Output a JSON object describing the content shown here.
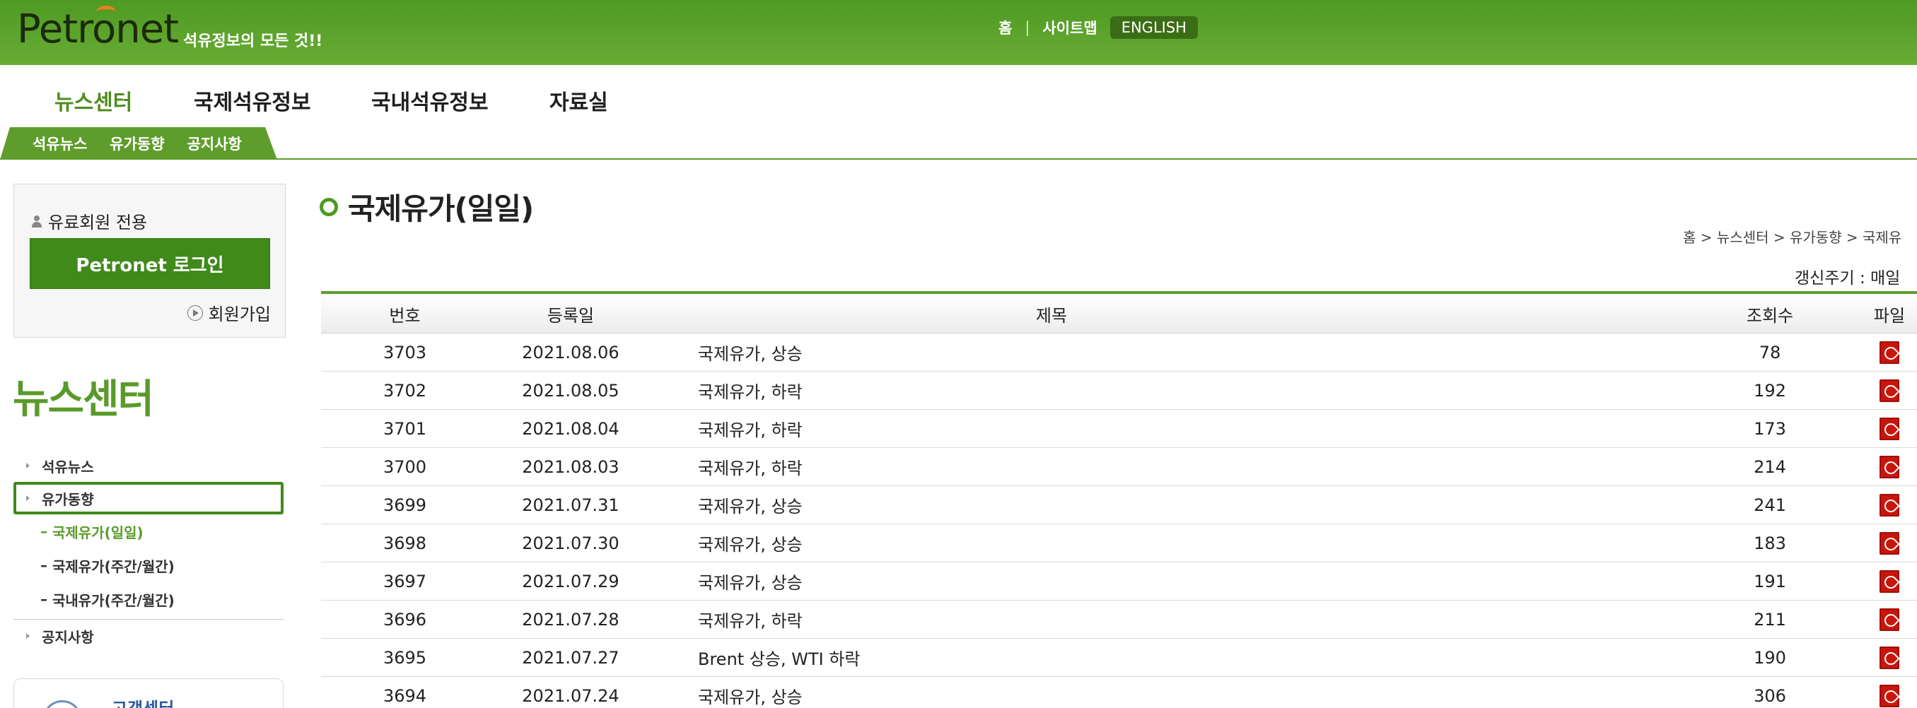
{
  "header": {
    "logo_text": "Petronet",
    "logo_sub": "석유정보의 모든 것!!",
    "links": {
      "home": "홈",
      "sep": "|",
      "sitemap": "사이트맵",
      "english": "ENGLISH"
    }
  },
  "nav": {
    "main": [
      "뉴스센터",
      "국제석유정보",
      "국내석유정보",
      "자료실"
    ],
    "sub": [
      "석유뉴스",
      "유가동향",
      "공지사항"
    ]
  },
  "login": {
    "head": "유료회원 전용",
    "button": "Petronet 로그인",
    "join": "회원가입"
  },
  "sidebar": {
    "title": "뉴스센터",
    "items": [
      {
        "label": "석유뉴스"
      },
      {
        "label": "유가동향"
      }
    ],
    "subitems": [
      "국제유가(일일)",
      "국제유가(주간/월간)",
      "국내유가(주간/월간)"
    ],
    "last_item": "공지사항",
    "cs_label": "고객센터"
  },
  "content": {
    "title": "국제유가(일일)",
    "breadcrumb": "홈 > 뉴스센터 > 유가동향 > 국제유",
    "refresh": "갱신주기 : 매일"
  },
  "table": {
    "headers": {
      "num": "번호",
      "date": "등록일",
      "title": "제목",
      "views": "조회수",
      "file": "파일"
    },
    "rows": [
      {
        "num": "3703",
        "date": "2021.08.06",
        "title": "국제유가, 상승",
        "views": "78"
      },
      {
        "num": "3702",
        "date": "2021.08.05",
        "title": "국제유가, 하락",
        "views": "192"
      },
      {
        "num": "3701",
        "date": "2021.08.04",
        "title": "국제유가, 하락",
        "views": "173"
      },
      {
        "num": "3700",
        "date": "2021.08.03",
        "title": "국제유가, 하락",
        "views": "214"
      },
      {
        "num": "3699",
        "date": "2021.07.31",
        "title": "국제유가, 상승",
        "views": "241"
      },
      {
        "num": "3698",
        "date": "2021.07.30",
        "title": "국제유가, 상승",
        "views": "183"
      },
      {
        "num": "3697",
        "date": "2021.07.29",
        "title": "국제유가, 상승",
        "views": "191"
      },
      {
        "num": "3696",
        "date": "2021.07.28",
        "title": "국제유가, 하락",
        "views": "211"
      },
      {
        "num": "3695",
        "date": "2021.07.27",
        "title": "Brent 상승, WTI 하락",
        "views": "190"
      },
      {
        "num": "3694",
        "date": "2021.07.24",
        "title": "국제유가, 상승",
        "views": "306"
      }
    ],
    "file_icon": "pdf-icon"
  },
  "colors": {
    "brand_green": "#4e9a22",
    "accent_green": "#5e9d2b",
    "pdf_red": "#c8160c"
  }
}
